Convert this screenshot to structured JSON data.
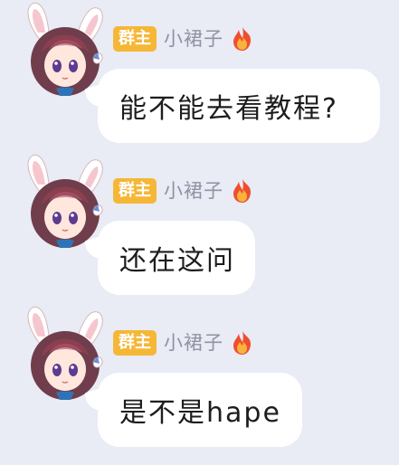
{
  "messages": [
    {
      "badge": "群主",
      "sender": "小裙子",
      "sender_icon": "fire-icon",
      "text": "能不能去看教程?"
    },
    {
      "badge": "群主",
      "sender": "小裙子",
      "sender_icon": "fire-icon",
      "text": "还在这问"
    },
    {
      "badge": "群主",
      "sender": "小裙子",
      "sender_icon": "fire-icon",
      "text": "是不是hape"
    }
  ],
  "colors": {
    "background": "#e9ebf5",
    "badge": "#f5b736",
    "bubble": "#ffffff",
    "sender_text": "#8f93a3",
    "message_text": "#1d1d1d"
  }
}
